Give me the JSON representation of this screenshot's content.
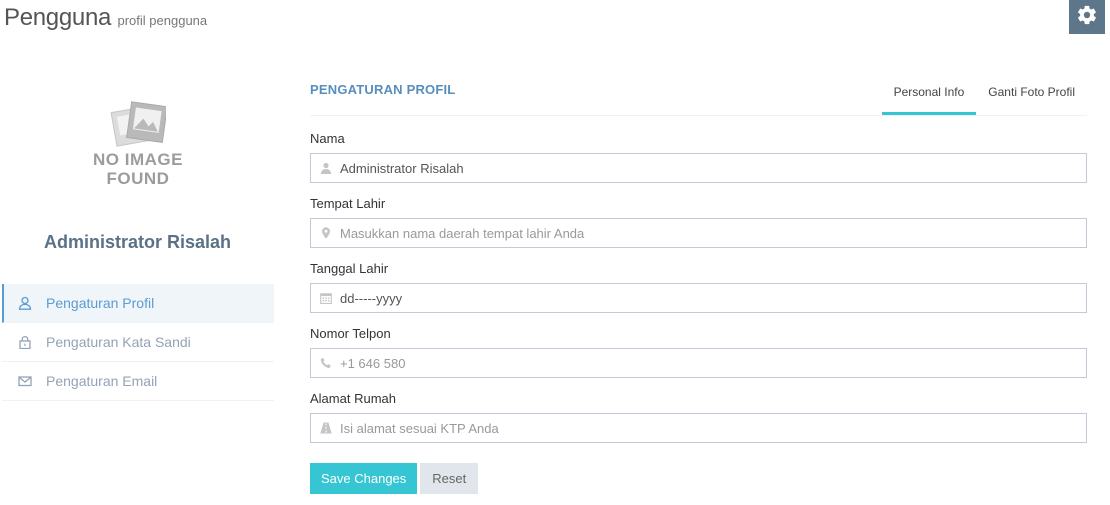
{
  "header": {
    "title": "Pengguna",
    "subtitle": "profil pengguna",
    "gear_icon": "gear-icon"
  },
  "profile": {
    "image_text_line1": "NO IMAGE",
    "image_text_line2": "FOUND",
    "name": "Administrator Risalah",
    "menu": [
      {
        "label": "Pengaturan Profil",
        "icon": "user-icon",
        "active": true
      },
      {
        "label": "Pengaturan Kata Sandi",
        "icon": "lock-icon",
        "active": false
      },
      {
        "label": "Pengaturan Email",
        "icon": "envelope-icon",
        "active": false
      }
    ]
  },
  "panel": {
    "title": "PENGATURAN PROFIL",
    "tabs": [
      {
        "label": "Personal Info",
        "active": true
      },
      {
        "label": "Ganti Foto Profil",
        "active": false
      }
    ]
  },
  "form": {
    "nama": {
      "label": "Nama",
      "value": "Administrator Risalah",
      "placeholder": "",
      "icon": "user-icon"
    },
    "tempat_lahir": {
      "label": "Tempat Lahir",
      "value": "",
      "placeholder": "Masukkan nama daerah tempat lahir Anda",
      "icon": "map-marker-icon"
    },
    "tanggal_lahir": {
      "label": "Tanggal Lahir",
      "value": "dd-----yyyy",
      "placeholder": "",
      "icon": "calendar-icon"
    },
    "nomor_telpon": {
      "label": "Nomor Telpon",
      "value": "",
      "placeholder": "+1 646 580",
      "icon": "phone-icon"
    },
    "alamat_rumah": {
      "label": "Alamat Rumah",
      "value": "",
      "placeholder": "Isi alamat sesuai KTP Anda",
      "icon": "road-icon"
    }
  },
  "buttons": {
    "save": "Save Changes",
    "reset": "Reset"
  },
  "colors": {
    "accent": "#36c6d3",
    "title_blue": "#578ebe",
    "menu_active": "#5b9bd1",
    "gear_bg": "#5d7689",
    "profile_name": "#5a7187"
  }
}
